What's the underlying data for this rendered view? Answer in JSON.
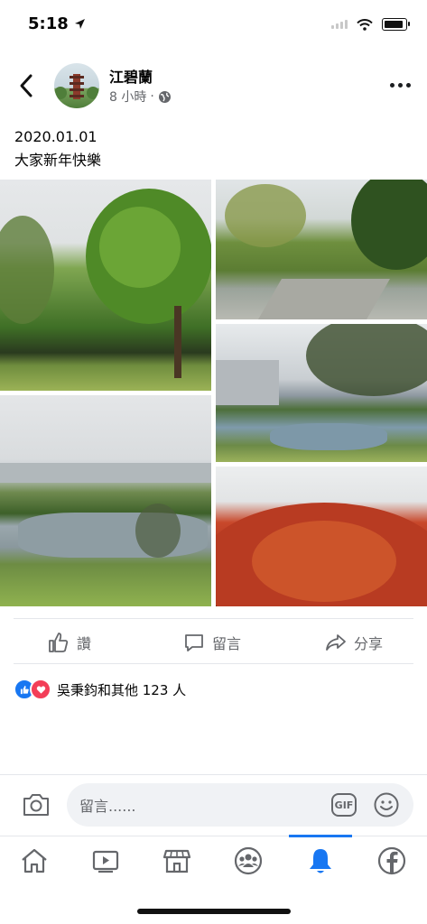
{
  "status_bar": {
    "time": "5:18"
  },
  "post": {
    "author": "江碧蘭",
    "time_ago": "8 小時",
    "separator": "·",
    "date_line": "2020.01.01",
    "message": "大家新年快樂"
  },
  "actions": {
    "like_label": "讚",
    "comment_label": "留言",
    "share_label": "分享"
  },
  "reactions": {
    "summary": "吳秉鈞和其他 123 人"
  },
  "comment_box": {
    "placeholder": "留言......",
    "gif_label": "GIF"
  },
  "tabs": [
    {
      "name": "home-tab",
      "icon": "home-icon"
    },
    {
      "name": "watch-tab",
      "icon": "video-icon"
    },
    {
      "name": "marketplace-tab",
      "icon": "store-icon"
    },
    {
      "name": "groups-tab",
      "icon": "groups-icon"
    },
    {
      "name": "notifications-tab",
      "icon": "bell-icon",
      "active": true
    },
    {
      "name": "menu-tab",
      "icon": "facebook-icon"
    }
  ],
  "colors": {
    "accent": "#1877f2",
    "love": "#f33e58",
    "muted": "#65676b"
  }
}
